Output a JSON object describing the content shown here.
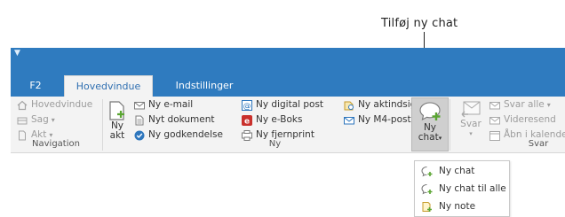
{
  "callout": {
    "text": "Tilføj ny chat"
  },
  "tabs": [
    {
      "label": "F2"
    },
    {
      "label": "Hovedvindue"
    },
    {
      "label": "Indstillinger"
    }
  ],
  "ribbon": {
    "navigation": {
      "items": [
        {
          "label": "Hovedvindue"
        },
        {
          "label": "Sag",
          "caret": "▾"
        },
        {
          "label": "Akt",
          "caret": "▾"
        }
      ],
      "group_label": "Navigation"
    },
    "ny": {
      "big_button": {
        "line1": "Ny",
        "line2": "akt"
      },
      "items": [
        {
          "label": "Ny e-mail"
        },
        {
          "label": "Nyt dokument"
        },
        {
          "label": "Ny godkendelse"
        },
        {
          "label": "Ny digital post"
        },
        {
          "label": "Ny e-Boks"
        },
        {
          "label": "Ny fjernprint"
        },
        {
          "label": "Ny aktindsigt"
        },
        {
          "label": "Ny M4-post"
        }
      ],
      "chat_button": {
        "line1": "Ny",
        "line2": "chat",
        "caret": "▾"
      },
      "group_label": "Ny"
    },
    "svar": {
      "big_button": {
        "label": "Svar",
        "caret": "▾"
      },
      "items": [
        {
          "label": "Svar alle",
          "caret": "▾"
        },
        {
          "label": "Videresend"
        },
        {
          "label": "Åbn i kalende"
        }
      ],
      "group_label": "Svar"
    }
  },
  "dropdown": {
    "items": [
      {
        "label": "Ny chat"
      },
      {
        "label": "Ny chat til alle"
      },
      {
        "label": "Ny note"
      }
    ]
  },
  "colors": {
    "title_bar": "#2f7bbf",
    "ribbon_bg": "#f3f3f3",
    "active_tab_text": "#2f6fb1",
    "chat_button_bg": "#cfcfcf",
    "green_accent": "#5aa532"
  }
}
